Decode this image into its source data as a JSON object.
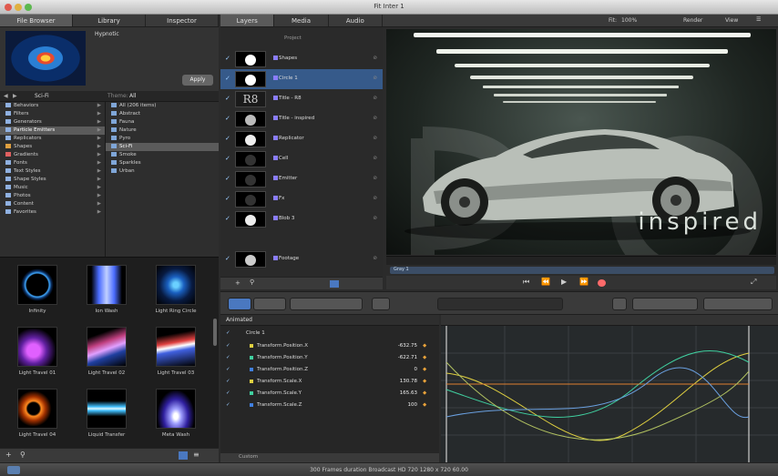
{
  "window": {
    "title": "Fit Inter 1"
  },
  "browser": {
    "tabs": [
      "File Browser",
      "Library",
      "Inspector"
    ],
    "preset_name": "Hypnotic",
    "apply_label": "Apply",
    "path": "Sci-Fi",
    "theme_label": "Theme:",
    "theme_value": "All",
    "categories": [
      {
        "label": "Behaviors",
        "color": "#8fb0e0"
      },
      {
        "label": "Filters",
        "color": "#8fb0e0"
      },
      {
        "label": "Generators",
        "color": "#8fb0e0"
      },
      {
        "label": "Particle Emitters",
        "color": "#8fb0e0",
        "selected": true
      },
      {
        "label": "Replicators",
        "color": "#8fb0e0"
      },
      {
        "label": "Shapes",
        "color": "#e0a040"
      },
      {
        "label": "Gradients",
        "color": "#e06060"
      },
      {
        "label": "Fonts",
        "color": "#8fb0e0"
      },
      {
        "label": "Text Styles",
        "color": "#8fb0e0"
      },
      {
        "label": "Shape Styles",
        "color": "#8fb0e0"
      },
      {
        "label": "Music",
        "color": "#8fb0e0"
      },
      {
        "label": "Photos",
        "color": "#8fb0e0"
      },
      {
        "label": "Content",
        "color": "#8fb0e0"
      },
      {
        "label": "Favorites",
        "color": "#8fb0e0"
      }
    ],
    "subcategories": [
      {
        "label": "All (206 items)"
      },
      {
        "label": "Abstract"
      },
      {
        "label": "Fauna"
      },
      {
        "label": "Nature"
      },
      {
        "label": "Pyro"
      },
      {
        "label": "Sci-Fi",
        "selected": true
      },
      {
        "label": "Smoke"
      },
      {
        "label": "Sparkles"
      },
      {
        "label": "Urban"
      }
    ],
    "thumbnails": [
      {
        "label": "Infinity"
      },
      {
        "label": "Ion Wash"
      },
      {
        "label": "Light Ring Circle"
      },
      {
        "label": "Light Travel 01"
      },
      {
        "label": "Light Travel 02"
      },
      {
        "label": "Light Travel 03"
      },
      {
        "label": "Light Travel 04"
      },
      {
        "label": "Liquid Transfer"
      },
      {
        "label": "Meta Wash"
      }
    ]
  },
  "layers_panel": {
    "tabs": [
      "Layers",
      "Media",
      "Audio"
    ],
    "project_label": "Project",
    "layers": [
      {
        "label": "Shapes"
      },
      {
        "label": "Circle 1",
        "selected": true
      },
      {
        "label": "Title - R8",
        "thumb_text": "R8"
      },
      {
        "label": "Title - inspired"
      },
      {
        "label": "Replicator"
      },
      {
        "label": "Cell"
      },
      {
        "label": "Emitter"
      },
      {
        "label": "Fx"
      },
      {
        "label": "Blob 3"
      },
      {
        "label": "Footage"
      }
    ]
  },
  "viewer": {
    "fit_label": "Fit:",
    "fit_value": "100%",
    "render_label": "Render",
    "view_label": "View",
    "overlay_text": "inspired",
    "clip_label": "Gray 1"
  },
  "animation": {
    "header": "Animated",
    "group": "Circle 1",
    "params": [
      {
        "label": "Transform.Position.X",
        "value": "-632.75",
        "color": "#e0d040"
      },
      {
        "label": "Transform.Position.Y",
        "value": "-622.71",
        "color": "#40d0a0"
      },
      {
        "label": "Transform.Position.Z",
        "value": "0",
        "color": "#4080e0"
      },
      {
        "label": "Transform.Scale.X",
        "value": "130.78",
        "color": "#e0d040"
      },
      {
        "label": "Transform.Scale.Y",
        "value": "165.63",
        "color": "#40d0a0"
      },
      {
        "label": "Transform.Scale.Z",
        "value": "100",
        "color": "#4080e0"
      }
    ],
    "footer_label": "Custom"
  },
  "status": {
    "text": "300 Frames duration Broadcast HD 720 1280 x 720 60.00"
  }
}
